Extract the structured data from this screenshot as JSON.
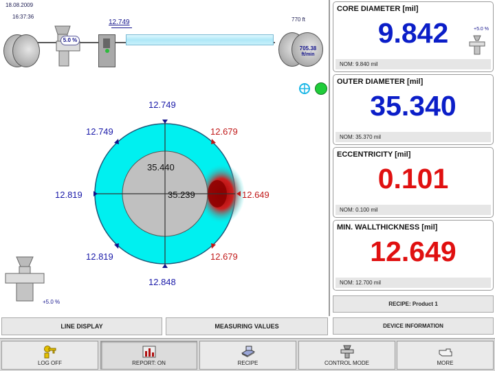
{
  "header": {
    "date": "18.08.2009",
    "time": "16:37:36",
    "length": "770 ft",
    "line_speed": "705.38",
    "line_speed_unit": "ft/min",
    "puller_percent": "5.0 %",
    "sensor_reading": "12.749"
  },
  "extruder_setpoint": "+5.0 %",
  "ring": {
    "outer_value": "35.440",
    "inner_value": "35.239",
    "labels": {
      "top": "12.749",
      "top_left": "12.749",
      "top_right": "12.679",
      "left": "12.819",
      "right": "12.649",
      "bottom_left": "12.819",
      "bottom_right": "12.679",
      "bottom": "12.848"
    }
  },
  "colors": {
    "ring_fill": "#00f0f0",
    "core_fill": "#c0c0c0",
    "blue_value": "#0b1ec8",
    "red_value": "#e01010",
    "status_ok": "#1fcc3a"
  },
  "tabs": {
    "line_display": "LINE DISPLAY",
    "measuring_values": "MEASURING VALUES"
  },
  "panels": [
    {
      "title": "CORE DIAMETER [mil]",
      "value": "9.842",
      "nominal": "NOM: 9.840 mil",
      "value_color": "blue",
      "side_note": "+5.0 %"
    },
    {
      "title": "OUTER DIAMETER [mil]",
      "value": "35.340",
      "nominal": "NOM: 35.370 mil",
      "value_color": "blue"
    },
    {
      "title": "ECCENTRICITY [mil]",
      "value": "0.101",
      "nominal": "NOM: 0.100 mil",
      "value_color": "red"
    },
    {
      "title": "MIN. WALLTHICKNESS [mil]",
      "value": "12.649",
      "nominal": "NOM: 12.700 mil",
      "value_color": "red"
    }
  ],
  "recipe_button": "RECIPE: Product 1",
  "device_info_button": "DEVICE INFORMATION",
  "toolbar": [
    {
      "label": "LOG OFF",
      "icon": "key-icon"
    },
    {
      "label": "REPORT: ON",
      "icon": "report-icon"
    },
    {
      "label": "RECIPE",
      "icon": "recipe-icon"
    },
    {
      "label": "CONTROL MODE",
      "icon": "extruder-icon"
    },
    {
      "label": "MORE",
      "icon": "hand-pointer-icon"
    }
  ]
}
